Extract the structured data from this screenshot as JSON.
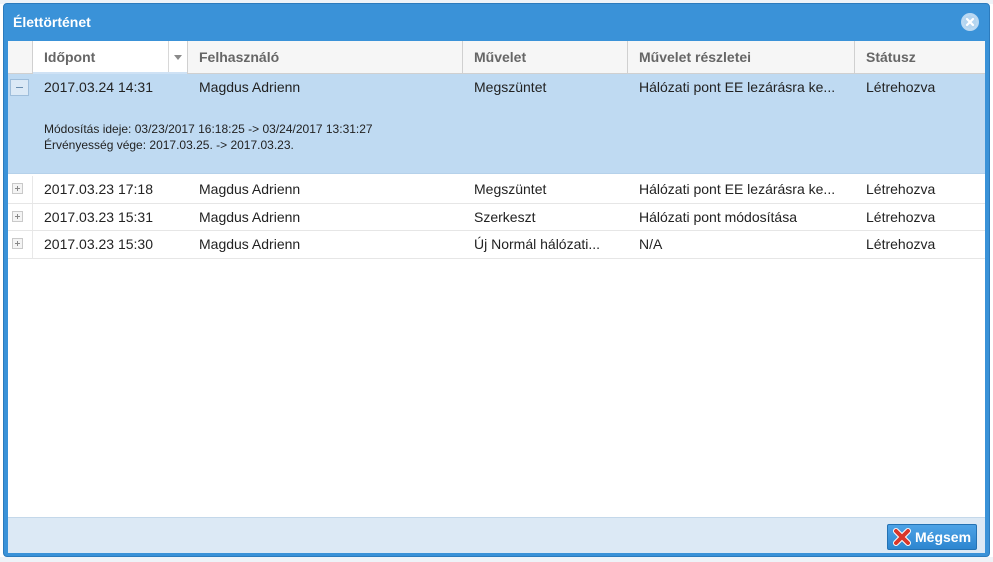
{
  "window": {
    "title": "Élettörténet"
  },
  "grid": {
    "columns": [
      {
        "label": "Időpont"
      },
      {
        "label": "Felhasználó"
      },
      {
        "label": "Művelet"
      },
      {
        "label": "Művelet részletei"
      },
      {
        "label": "Státusz"
      }
    ],
    "rows": [
      {
        "time": "2017.03.24 14:31",
        "user": "Magdus Adrienn",
        "action": "Megszüntet",
        "details": "Hálózati pont EE lezárásra ke...",
        "status": "Létrehozva",
        "expanded": true,
        "detail_lines": [
          "Módosítás ideje: 03/23/2017 16:18:25 -> 03/24/2017 13:31:27",
          "Érvényesség vége: 2017.03.25. -> 2017.03.23."
        ]
      },
      {
        "time": "2017.03.23 17:18",
        "user": "Magdus Adrienn",
        "action": "Megszüntet",
        "details": "Hálózati pont EE lezárásra ke...",
        "status": "Létrehozva",
        "expanded": false
      },
      {
        "time": "2017.03.23 15:31",
        "user": "Magdus Adrienn",
        "action": "Szerkeszt",
        "details": "Hálózati pont módosítása",
        "status": "Létrehozva",
        "expanded": false
      },
      {
        "time": "2017.03.23 15:30",
        "user": "Magdus Adrienn",
        "action": "Új Normál hálózati...",
        "details": "N/A",
        "status": "Létrehozva",
        "expanded": false
      }
    ]
  },
  "footer": {
    "cancel_label": "Mégsem",
    "cancel_icon": "red-x-icon"
  },
  "colors": {
    "window_blue": "#3a92d8",
    "selected_row": "#bfdaf2",
    "footer_bg": "#dce9f5"
  }
}
